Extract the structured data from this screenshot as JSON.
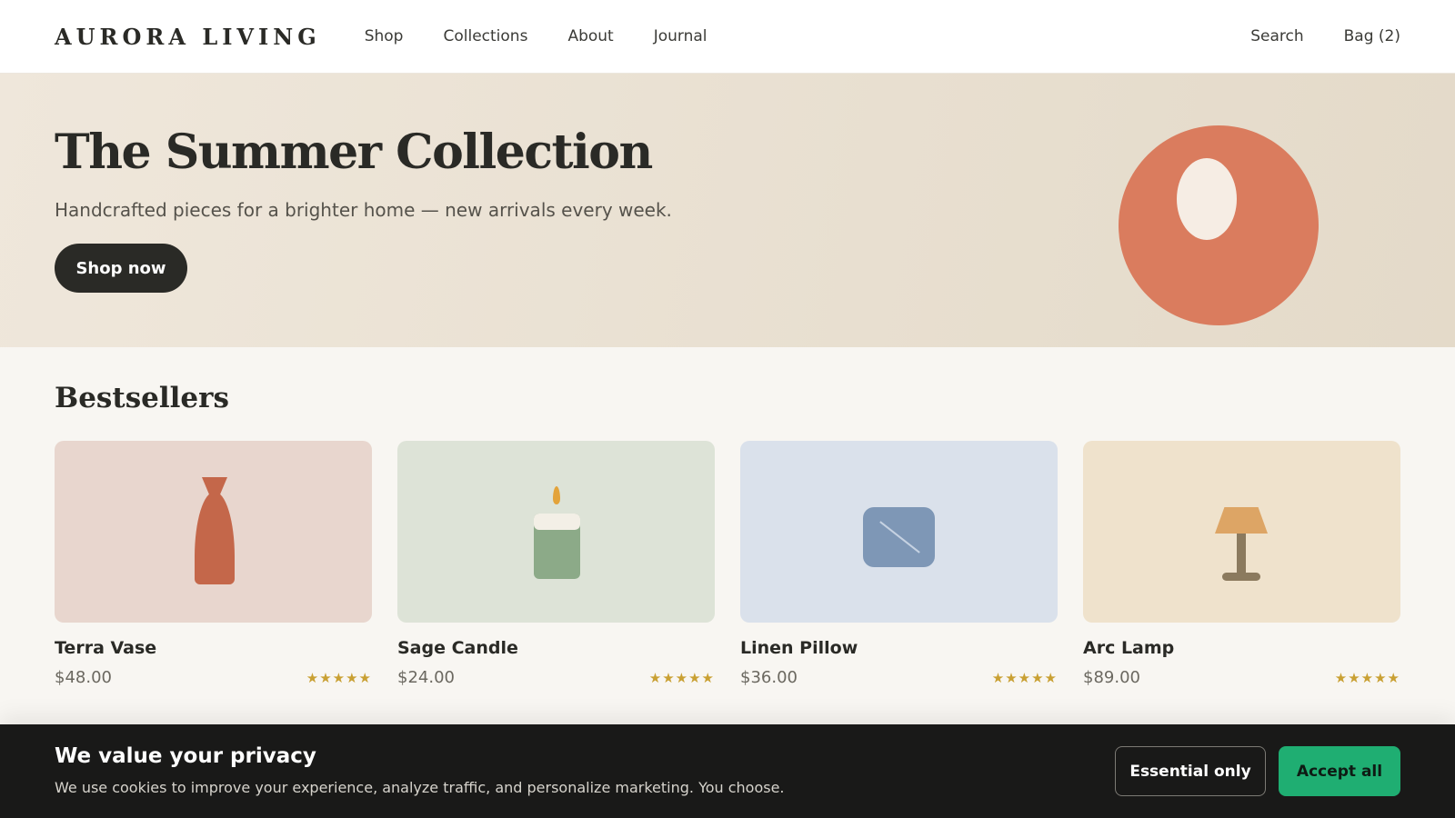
{
  "header": {
    "logo": "AURORA LIVING",
    "nav": [
      "Shop",
      "Collections",
      "About",
      "Journal"
    ],
    "search_label": "Search",
    "bag_label": "Bag (2)"
  },
  "hero": {
    "title": "The Summer Collection",
    "subtitle": "Handcrafted pieces for a brighter home — new arrivals every week.",
    "cta_label": "Shop now",
    "art_colors": {
      "circle": "#da7c5e",
      "egg": "#f6ede4"
    }
  },
  "bestsellers": {
    "title": "Bestsellers",
    "products": [
      {
        "name": "Terra Vase",
        "price": "$48.00",
        "rating": 5,
        "icon": "vase-icon",
        "bg": "#e8d6ce"
      },
      {
        "name": "Sage Candle",
        "price": "$24.00",
        "rating": 5,
        "icon": "candle-icon",
        "bg": "#dde3d7"
      },
      {
        "name": "Linen Pillow",
        "price": "$36.00",
        "rating": 5,
        "icon": "pillow-icon",
        "bg": "#dae1eb"
      },
      {
        "name": "Arc Lamp",
        "price": "$89.00",
        "rating": 5,
        "icon": "lamp-icon",
        "bg": "#efe2cc"
      }
    ]
  },
  "cookie_banner": {
    "title": "We value your privacy",
    "text": "We use cookies to improve your experience, analyze traffic, and personalize marketing. You choose.",
    "essential_label": "Essential only",
    "accept_label": "Accept all"
  },
  "colors": {
    "accent_dark": "#2a2a26",
    "accept_green": "#1fae72",
    "star_gold": "#c9a033"
  }
}
